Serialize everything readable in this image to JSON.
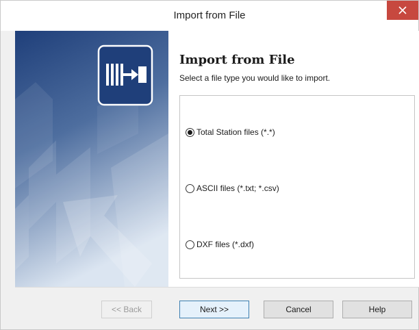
{
  "window": {
    "title": "Import from File",
    "close_glyph": "✕"
  },
  "page": {
    "heading": "Import from File",
    "subheading": "Select a file type you would like to import."
  },
  "options": [
    {
      "label": "Total Station files (*.*)",
      "checked": true
    },
    {
      "label": "ASCII files (*.txt; *.csv)",
      "checked": false
    },
    {
      "label": "DXF files (*.dxf)",
      "checked": false
    }
  ],
  "buttons": {
    "back": "<< Back",
    "next": "Next >>",
    "cancel": "Cancel",
    "help": "Help"
  },
  "colors": {
    "banner_dark": "#1f3f7a",
    "banner_light": "#d9e4f2",
    "close_red": "#c7483f",
    "default_button_border": "#3c7fb1"
  },
  "icons": {
    "close": "close-icon",
    "banner": "import-file-icon"
  }
}
